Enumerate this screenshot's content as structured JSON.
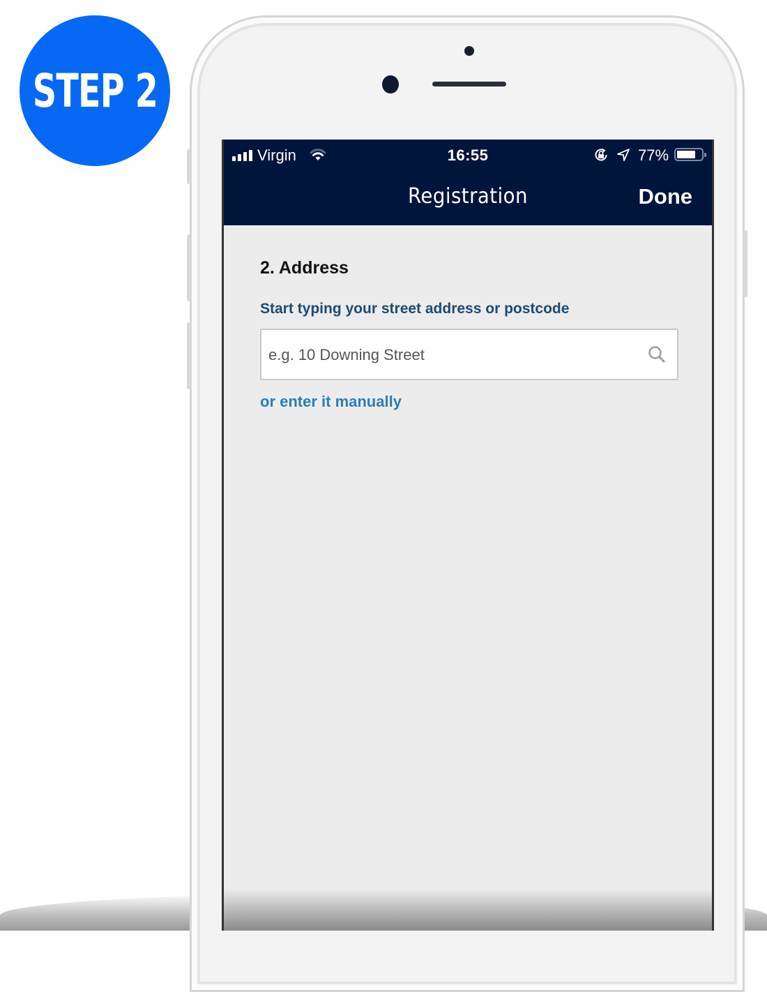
{
  "badge": {
    "label": "STEP 2",
    "color": "#0569f5"
  },
  "status_bar": {
    "carrier": "Virgin",
    "time": "16:55",
    "battery_percent_label": "77%",
    "battery_level": 0.77,
    "icons": [
      "signal-bars-icon",
      "wifi-icon",
      "rotation-lock-icon",
      "location-arrow-icon",
      "battery-icon"
    ]
  },
  "nav_bar": {
    "title": "Registration",
    "done_label": "Done",
    "background_color": "#00153c"
  },
  "form": {
    "section_title": "2. Address",
    "field_label": "Start typing your street address or postcode",
    "search_input": {
      "value": "",
      "placeholder": "e.g. 10 Downing Street",
      "icon": "search-icon"
    },
    "manual_link": "or enter it manually",
    "label_color": "#1d4a72",
    "link_color": "#2a7db6"
  }
}
